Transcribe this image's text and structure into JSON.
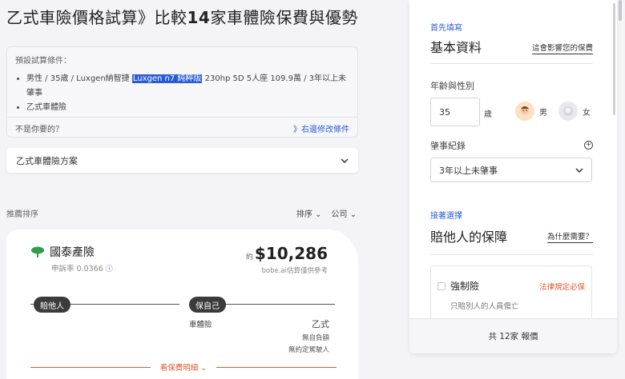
{
  "header": {
    "title_prefix": "乙式車險價格試算》比較",
    "title_count": "14",
    "title_suffix": "家車體險保費與優勢"
  },
  "conditions": {
    "heading": "預設試算條件：",
    "item1_pre": "男性 / 35歲 / Luxgen納智捷 ",
    "item1_highlight": "Luxgen n7 純粹版",
    "item1_post": " 230hp 5D 5人座 109.9萬 / 3年以上未肇事",
    "item2": "乙式車體險",
    "question": "不是你要的？",
    "edit_link": "》右邊修改條件"
  },
  "plan_select": {
    "value": "乙式車體險方案"
  },
  "sort": {
    "label": "推薦排序",
    "sort_button": "排序",
    "company_button": "公司"
  },
  "card": {
    "brand": "國泰產險",
    "claim_rate": "申訴率 0.0366",
    "price_prefix": "約",
    "price": "$10,286",
    "price_note": "bobe.ai估算僅供參考",
    "pill_left": "賠他人",
    "pill_right": "保自己",
    "coverage_label": "車體險",
    "coverage_type": "乙式",
    "note1": "無自負額",
    "note2": "無約定駕駛人",
    "detail_link": "看保費明細"
  },
  "sidebar": {
    "step1": "首先填寫",
    "section1_title": "基本資料",
    "section1_link": "這會影響您的保費",
    "age_gender_label": "年齡與性別",
    "age_value": "35",
    "age_unit": "歲",
    "male": "男",
    "female": "女",
    "record_label": "肇事紀錄",
    "record_value": "3年以上未肇事",
    "step2": "接著選擇",
    "section2_title": "賠他人的保障",
    "section2_link": "為什麼需要？",
    "coverage_name": "強制險",
    "coverage_required": "法律規定必保",
    "coverage_desc": "只賠別人的人員傷亡",
    "footer": "共 12家 報價"
  },
  "colors": {
    "accent": "#2a5bd7",
    "warning": "#e05a2b",
    "pill": "#3b3b3b"
  }
}
